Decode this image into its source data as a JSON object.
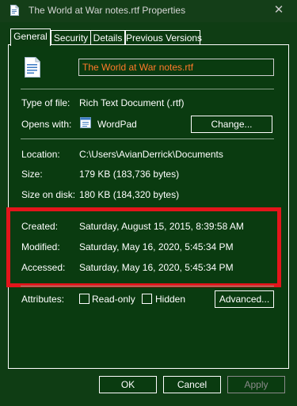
{
  "window": {
    "title": "The World at War notes.rtf Properties",
    "close_glyph": "✕"
  },
  "tabs": [
    {
      "label": "General",
      "active": true
    },
    {
      "label": "Security",
      "active": false
    },
    {
      "label": "Details",
      "active": false
    },
    {
      "label": "Previous Versions",
      "active": false
    }
  ],
  "general": {
    "file_name": "The World at War notes.rtf",
    "type_label": "Type of file:",
    "type_value": "Rich Text Document (.rtf)",
    "opens_label": "Opens with:",
    "opens_value": "WordPad",
    "change_button": "Change...",
    "location_label": "Location:",
    "location_value": "C:\\Users\\AvianDerrick\\Documents",
    "size_label": "Size:",
    "size_value": "179 KB (183,736 bytes)",
    "size_disk_label": "Size on disk:",
    "size_disk_value": "180 KB (184,320 bytes)",
    "created_label": "Created:",
    "created_value": "Saturday, August 15, 2015, 8:39:58 AM",
    "modified_label": "Modified:",
    "modified_value": "Saturday, May 16, 2020, 5:45:34 PM",
    "accessed_label": "Accessed:",
    "accessed_value": "Saturday, May 16, 2020, 5:45:34 PM",
    "attributes_label": "Attributes:",
    "readonly_label": "Read-only",
    "readonly_checked": false,
    "hidden_label": "Hidden",
    "hidden_checked": false,
    "advanced_button": "Advanced..."
  },
  "footer": {
    "ok": "OK",
    "cancel": "Cancel",
    "apply": "Apply",
    "apply_enabled": false
  },
  "colors": {
    "background": "#0a3b10",
    "filename_text": "#ff7a2a",
    "highlight_border": "#e3151b"
  },
  "icons": {
    "title": "document-icon",
    "file": "rtf-document-icon",
    "opens_with": "wordpad-icon",
    "close": "close-icon"
  }
}
